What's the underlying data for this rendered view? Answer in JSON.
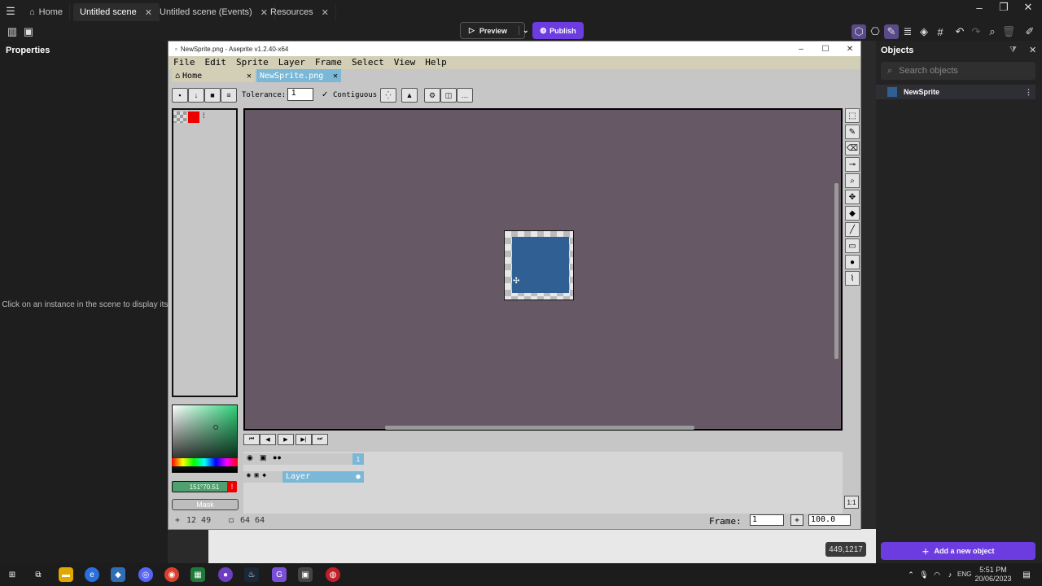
{
  "tabs": [
    {
      "label": "Home"
    },
    {
      "label": "Untitled scene"
    },
    {
      "label": "Untitled scene (Events)"
    },
    {
      "label": "Resources"
    }
  ],
  "toolbar": {
    "preview_label": "Preview",
    "publish_label": "Publish"
  },
  "left_panel": {
    "title": "Properties",
    "hint": "Click on an instance in the scene to display its properties"
  },
  "right_panel": {
    "title": "Objects",
    "search_placeholder": "Search objects",
    "objects": [
      {
        "name": "NewSprite"
      }
    ],
    "add_label": "Add a new object"
  },
  "coordinates": "449,1217",
  "aseprite": {
    "title": "NewSprite.png - Aseprite v1.2.40-x64",
    "menu": [
      "File",
      "Edit",
      "Sprite",
      "Layer",
      "Frame",
      "Select",
      "View",
      "Help"
    ],
    "tabs": [
      "Home",
      "NewSprite.png"
    ],
    "tolerance_label": "Tolerance:",
    "tolerance_value": "1",
    "contiguous_label": "Contiguous",
    "fg_color": "151°70.51",
    "mask_label": "Mask",
    "layer_name": "Layer",
    "frame_number": "1",
    "status_pos": "12 49",
    "status_size": "64 64",
    "frame_label": "Frame:",
    "frame_value": "1",
    "zoom_value": "100.0"
  },
  "taskbar": {
    "lang": "ENG",
    "time": "5:51 PM",
    "date": "20/06/2023"
  },
  "colors": {
    "accent": "#6c3ce0",
    "canvas_bg": "#675866",
    "sprite_fill": "#2f5f93"
  }
}
